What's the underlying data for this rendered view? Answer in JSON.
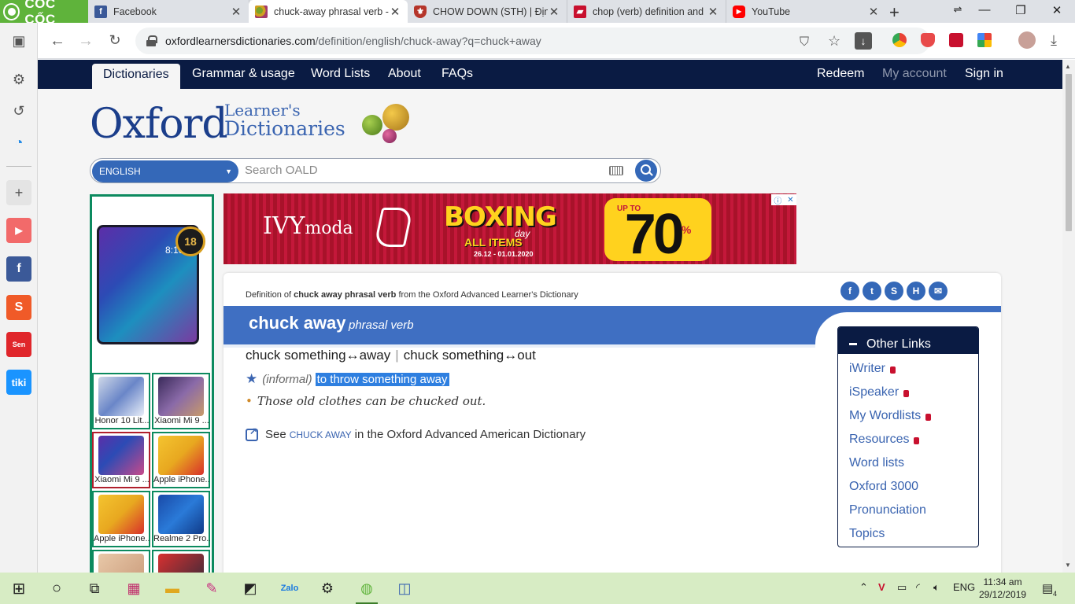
{
  "browser": {
    "brand": "CỐC CỐC",
    "tabs": [
      {
        "title": "Facebook",
        "active": false
      },
      {
        "title": "chuck-away phrasal verb - D",
        "active": true
      },
      {
        "title": "CHOW DOWN (STH) | Định",
        "active": false
      },
      {
        "title": "chop (verb) definition and s",
        "active": false
      },
      {
        "title": "YouTube",
        "active": false
      }
    ],
    "url_host": "oxfordlearnersdictionaries.com",
    "url_path": "/definition/english/chuck-away?q=chuck+away"
  },
  "site_nav": {
    "left": [
      "Dictionaries",
      "Grammar & usage",
      "Word Lists",
      "About",
      "FAQs"
    ],
    "right": [
      "Redeem",
      "My account",
      "Sign in"
    ]
  },
  "logo": {
    "main": "Oxford",
    "sub1": "Learner's",
    "sub2": "Dictionaries"
  },
  "search": {
    "language": "ENGLISH",
    "placeholder": "Search OALD"
  },
  "side_ad": {
    "products": [
      {
        "caption": "Honor 10 Lit..."
      },
      {
        "caption": "Xiaomi Mi 9 ..."
      },
      {
        "caption": "Xiaomi Mi 9 ..."
      },
      {
        "caption": "Apple iPhone..."
      },
      {
        "caption": "Apple iPhone..."
      },
      {
        "caption": "Realme 2 Pro..."
      }
    ]
  },
  "banner": {
    "brand": "IVY",
    "brand_suffix": "moda",
    "headline": "BOXING",
    "sub": "day",
    "items": "ALL ITEMS",
    "dates": "26.12 - 01.01.2020",
    "upto": "UP TO",
    "discount": "70",
    "percent": "%"
  },
  "entry": {
    "source_prefix": "Definition of",
    "source_word": "chuck away phrasal verb",
    "source_suffix": "from the Oxford Advanced Learner's Dictionary",
    "headword": "chuck away",
    "pos": "phrasal verb",
    "usage_1": "chuck something↔away",
    "usage_sep": "|",
    "usage_2": "chuck something↔out",
    "label": "(informal)",
    "definition": "to throw something away",
    "example": "Those old clothes can be chucked out.",
    "see_prefix": "See",
    "see_word": "chuck away",
    "see_suffix": "in the Oxford Advanced American Dictionary"
  },
  "other_links": {
    "title": "Other Links",
    "items": [
      {
        "label": "iWriter",
        "locked": true
      },
      {
        "label": "iSpeaker",
        "locked": true
      },
      {
        "label": "My Wordlists",
        "locked": true
      },
      {
        "label": "Resources",
        "locked": true
      },
      {
        "label": "Word lists",
        "locked": false
      },
      {
        "label": "Oxford 3000",
        "locked": false
      },
      {
        "label": "Pronunciation",
        "locked": false
      },
      {
        "label": "Topics",
        "locked": false
      }
    ]
  },
  "taskbar": {
    "lang": "ENG",
    "time": "11:34 am",
    "date": "29/12/2019",
    "notifications": "4"
  },
  "colors": {
    "oxford_navy": "#0a1b43",
    "oxford_blue": "#3f6fc2",
    "selection": "#2e7fe0",
    "coccoc_green": "#5fb33b",
    "ad_border": "#0c8a5f"
  }
}
